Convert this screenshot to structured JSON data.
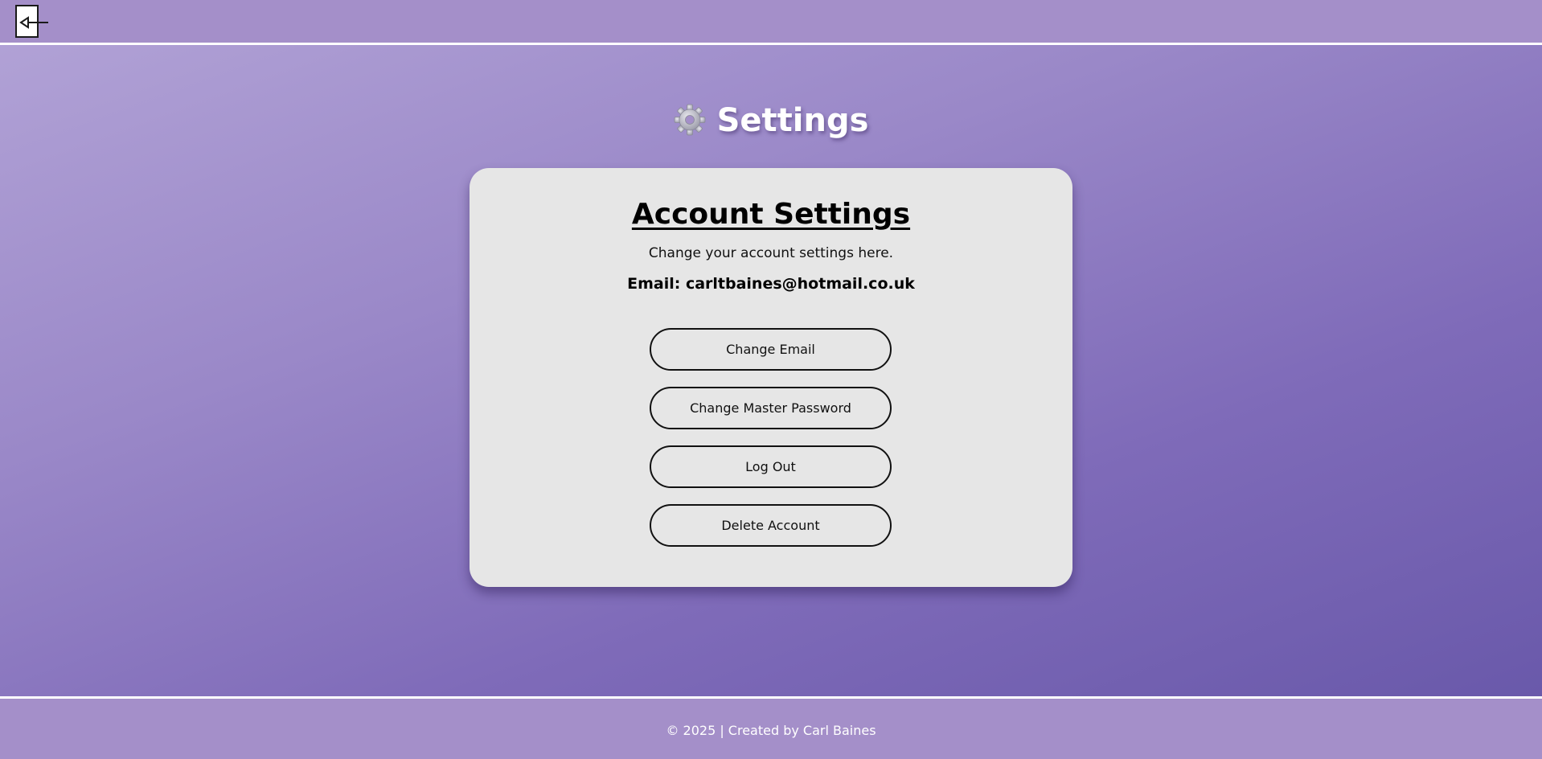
{
  "header": {
    "back_icon": "back-arrow-icon"
  },
  "page": {
    "title_icon": "gear-icon",
    "title": "Settings"
  },
  "card": {
    "title": "Account Settings",
    "subtitle": "Change your account settings here.",
    "email_line": "Email: carltbaines@hotmail.co.uk",
    "buttons": [
      {
        "label": "Change Email"
      },
      {
        "label": "Change Master Password"
      },
      {
        "label": "Log Out"
      },
      {
        "label": "Delete Account"
      }
    ]
  },
  "footer": {
    "text": "© 2025 | Created by Carl Baines"
  },
  "colors": {
    "bar_background": "#a48fc9",
    "card_background": "#e6e6e6",
    "gradient_start": "#b3a4d7",
    "gradient_end": "#6656a8"
  }
}
